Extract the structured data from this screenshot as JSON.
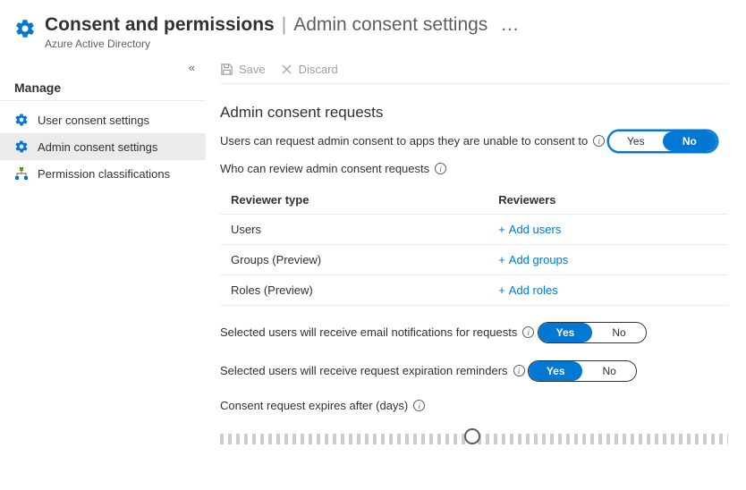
{
  "header": {
    "title_primary": "Consent and permissions",
    "title_secondary": "Admin consent settings",
    "subtitle": "Azure Active Directory",
    "ellipsis": "…"
  },
  "sidebar": {
    "heading": "Manage",
    "items": [
      {
        "label": "User consent settings"
      },
      {
        "label": "Admin consent settings"
      },
      {
        "label": "Permission classifications"
      }
    ]
  },
  "cmdbar": {
    "save": "Save",
    "discard": "Discard"
  },
  "section": {
    "title": "Admin consent requests",
    "request_consent_label": "Users can request admin consent to apps they are unable to consent to",
    "request_consent_yes": "Yes",
    "request_consent_no": "No",
    "review_heading": "Who can review admin consent requests",
    "table_header_type": "Reviewer type",
    "table_header_reviewers": "Reviewers",
    "rows": [
      {
        "type": "Users",
        "action": "Add users"
      },
      {
        "type": "Groups (Preview)",
        "action": "Add groups"
      },
      {
        "type": "Roles (Preview)",
        "action": "Add roles"
      }
    ],
    "email_notify_label": "Selected users will receive email notifications for requests",
    "email_notify_yes": "Yes",
    "email_notify_no": "No",
    "expiry_reminders_label": "Selected users will receive request expiration reminders",
    "expiry_reminders_yes": "Yes",
    "expiry_reminders_no": "No",
    "expires_label": "Consent request expires after (days)"
  },
  "slider": {
    "percent": 48
  }
}
